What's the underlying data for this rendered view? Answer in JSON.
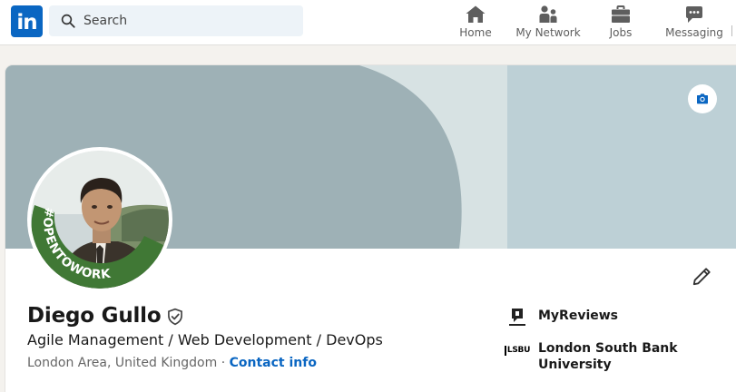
{
  "nav": {
    "logo_text": "in",
    "search": {
      "placeholder": "Search"
    },
    "items": [
      {
        "label": "Home",
        "icon": "home-icon"
      },
      {
        "label": "My Network",
        "icon": "people-icon"
      },
      {
        "label": "Jobs",
        "icon": "briefcase-icon"
      },
      {
        "label": "Messaging",
        "icon": "chat-icon"
      }
    ]
  },
  "profile": {
    "name": "Diego Gullo",
    "headline": "Agile Management / Web Development / DevOps",
    "location": "London Area, United Kingdom",
    "separator": "·",
    "contact_label": "Contact info",
    "avatar_badge": "#OPENTOWORK",
    "organizations": [
      {
        "name": "MyReviews",
        "logo": "myreviews-logo"
      },
      {
        "name": "London South Bank University",
        "logo_text": "LSBU"
      }
    ]
  },
  "colors": {
    "brand": "#0a66c2",
    "banner_light": "#bdd0d6",
    "banner_dark": "#9eb1b6",
    "opentowork_green": "#407835"
  }
}
